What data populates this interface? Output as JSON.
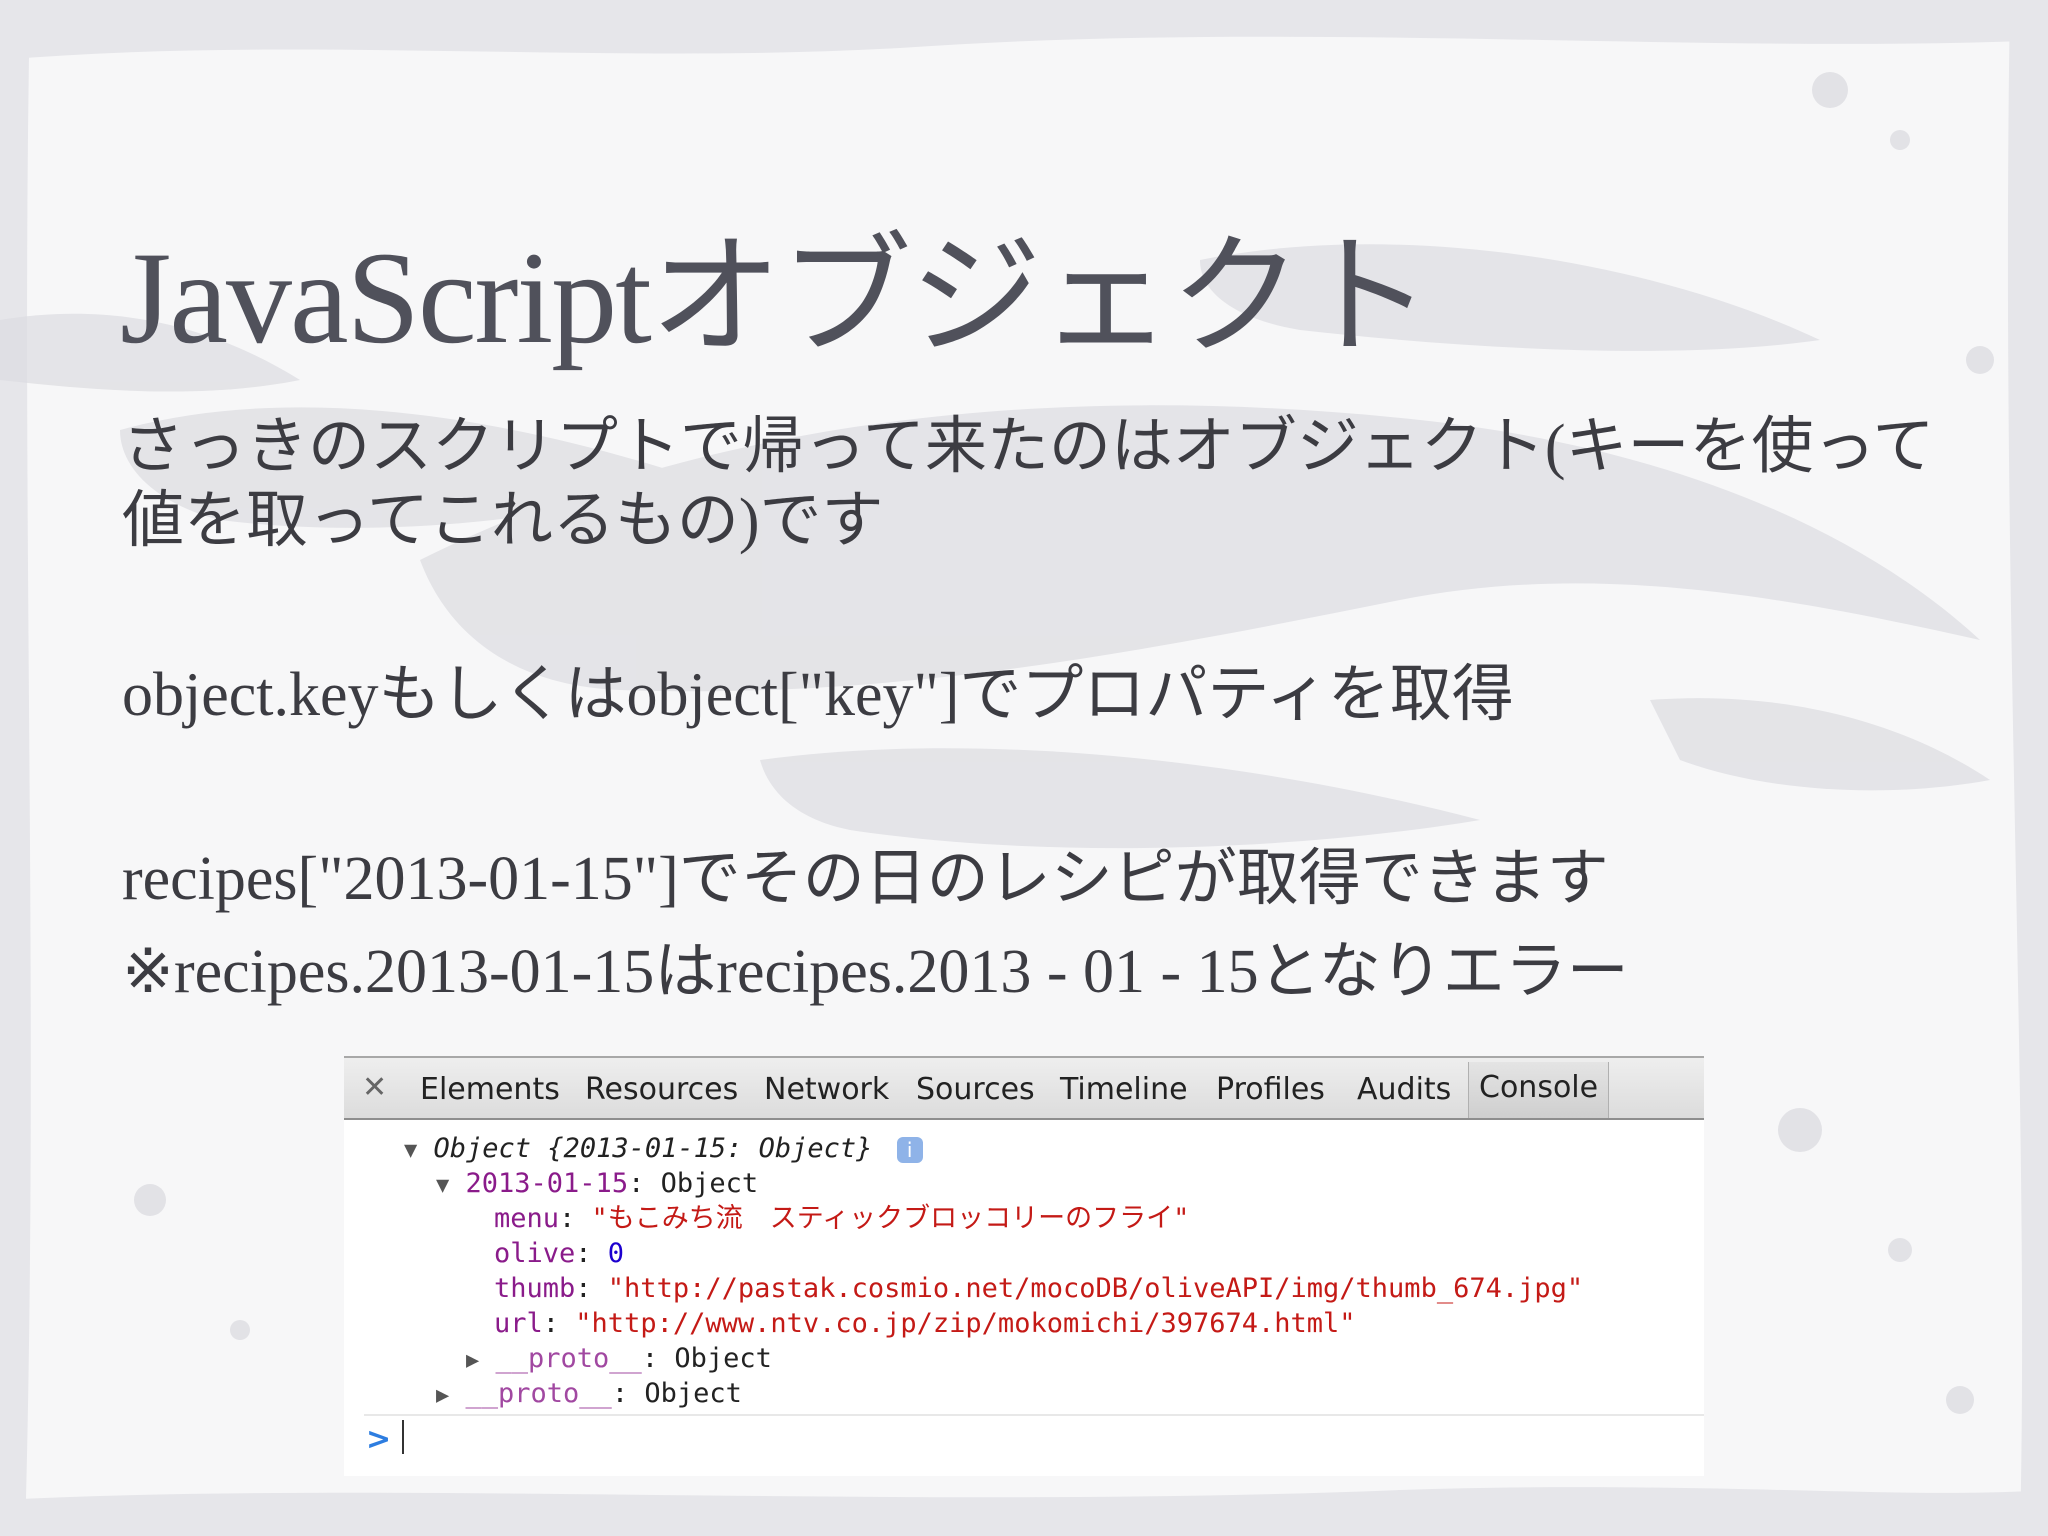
{
  "slide": {
    "title": "JavaScriptオブジェクト",
    "paragraph1_line1": "さっきのスクリプトで帰って来たのはオブジェクト(キーを使って",
    "paragraph1_line2": "値を取ってこれるもの)です",
    "paragraph2": "object.keyもしくはobject[\"key\"]でプロパティを取得",
    "paragraph3": "recipes[\"2013-01-15\"]でその日のレシピが取得できます",
    "paragraph4": "※recipes.2013-01-15はrecipes.2013 - 01 - 15となりエラー"
  },
  "devtools": {
    "close_icon": "close-icon",
    "tabs": [
      "Elements",
      "Resources",
      "Network",
      "Sources",
      "Timeline",
      "Profiles",
      "Audits",
      "Console"
    ],
    "active_tab": "Console",
    "console": {
      "line1": "Object {2013-01-15: Object}",
      "line2_key": "2013-01-15",
      "line2_val": "Object",
      "menu_key": "menu",
      "menu_val": "\"もこみち流　スティックブロッコリーのフライ\"",
      "olive_key": "olive",
      "olive_val": "0",
      "thumb_key": "thumb",
      "thumb_val": "\"http://pastak.cosmio.net/mocoDB/oliveAPI/img/thumb_674.jpg\"",
      "url_key": "url",
      "url_val": "\"http://www.ntv.co.jp/zip/mokomichi/397674.html\"",
      "proto_key": "__proto__",
      "proto_val": "Object",
      "prompt": ">"
    }
  }
}
